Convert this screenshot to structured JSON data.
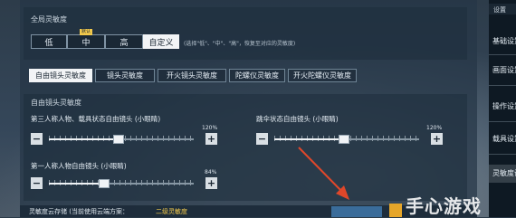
{
  "topbar": {
    "settings_label": "设置"
  },
  "global": {
    "title": "全局灵敏度",
    "options": [
      "低",
      "中",
      "高",
      "自定义"
    ],
    "default_tag": "默认",
    "hint": "(选择\"低\"、\"中\"、\"高\"，恢复至对应的灵敏度)"
  },
  "tabs": [
    "自由镜头灵敏度",
    "镜头灵敏度",
    "开火镜头灵敏度",
    "陀螺仪灵敏度",
    "开火陀螺仪灵敏度"
  ],
  "free_cam": {
    "title": "自由镜头灵敏度",
    "sliders": [
      {
        "label": "第三人称人物、载具状态自由镜头 (小眼睛)",
        "value": "120%",
        "level": 0.48
      },
      {
        "label": "跳伞状态自由镜头 (小眼睛)",
        "value": "120%",
        "level": 0.48
      },
      {
        "label": "第一人称人物自由镜头 (小眼睛)",
        "value": "84%",
        "level": 0.38
      }
    ]
  },
  "bottom": {
    "text": "灵敏度云存储 (当前使用云端方案：",
    "link": "二级灵敏度"
  },
  "sidebar": {
    "items": [
      "基础设置",
      "画面设置",
      "操作设置",
      "载具设置",
      "灵敏度设置"
    ]
  },
  "watermark": "手心游戏",
  "colors": {
    "active": "#f2f4f6",
    "tag": "#f2c94c",
    "arrow": "#e0472a"
  }
}
